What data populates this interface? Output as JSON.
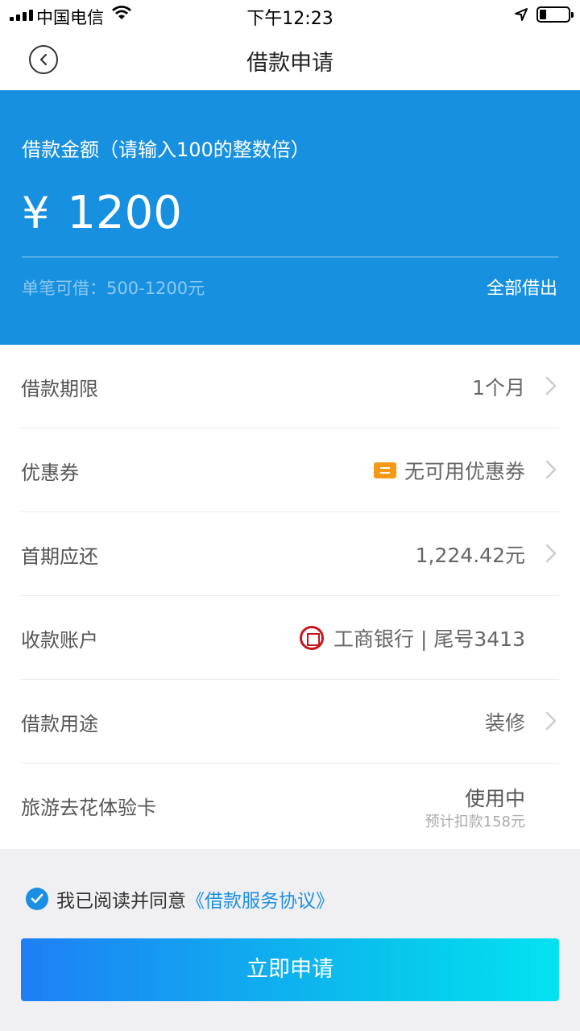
{
  "status_bar": {
    "carrier": "中国电信",
    "time": "下午12:23"
  },
  "nav": {
    "title": "借款申请"
  },
  "amount_panel": {
    "label": "借款金额（请输入100的整数倍）",
    "currency": "¥",
    "amount": "1200",
    "limit_text": "单笔可借：500-1200元",
    "borrow_all": "全部借出"
  },
  "rows": [
    {
      "label": "借款期限",
      "value": "1个月"
    },
    {
      "label": "优惠券",
      "value": "无可用优惠券"
    },
    {
      "label": "首期应还",
      "value": "1,224.42元"
    },
    {
      "label": "收款账户",
      "value": "工商银行 | 尾号3413"
    },
    {
      "label": "借款用途",
      "value": "装修"
    },
    {
      "label": "旅游去花体验卡",
      "value": "使用中",
      "sub": "预计扣款158元"
    }
  ],
  "agreement": {
    "text": "我已阅读并同意",
    "link": "《借款服务协议》"
  },
  "apply_button": "立即申请",
  "colors": {
    "primary_blue": "#1890e0",
    "link_blue": "#1a8fe3",
    "coupon_orange": "#f59a16",
    "bank_red": "#c8161d"
  }
}
